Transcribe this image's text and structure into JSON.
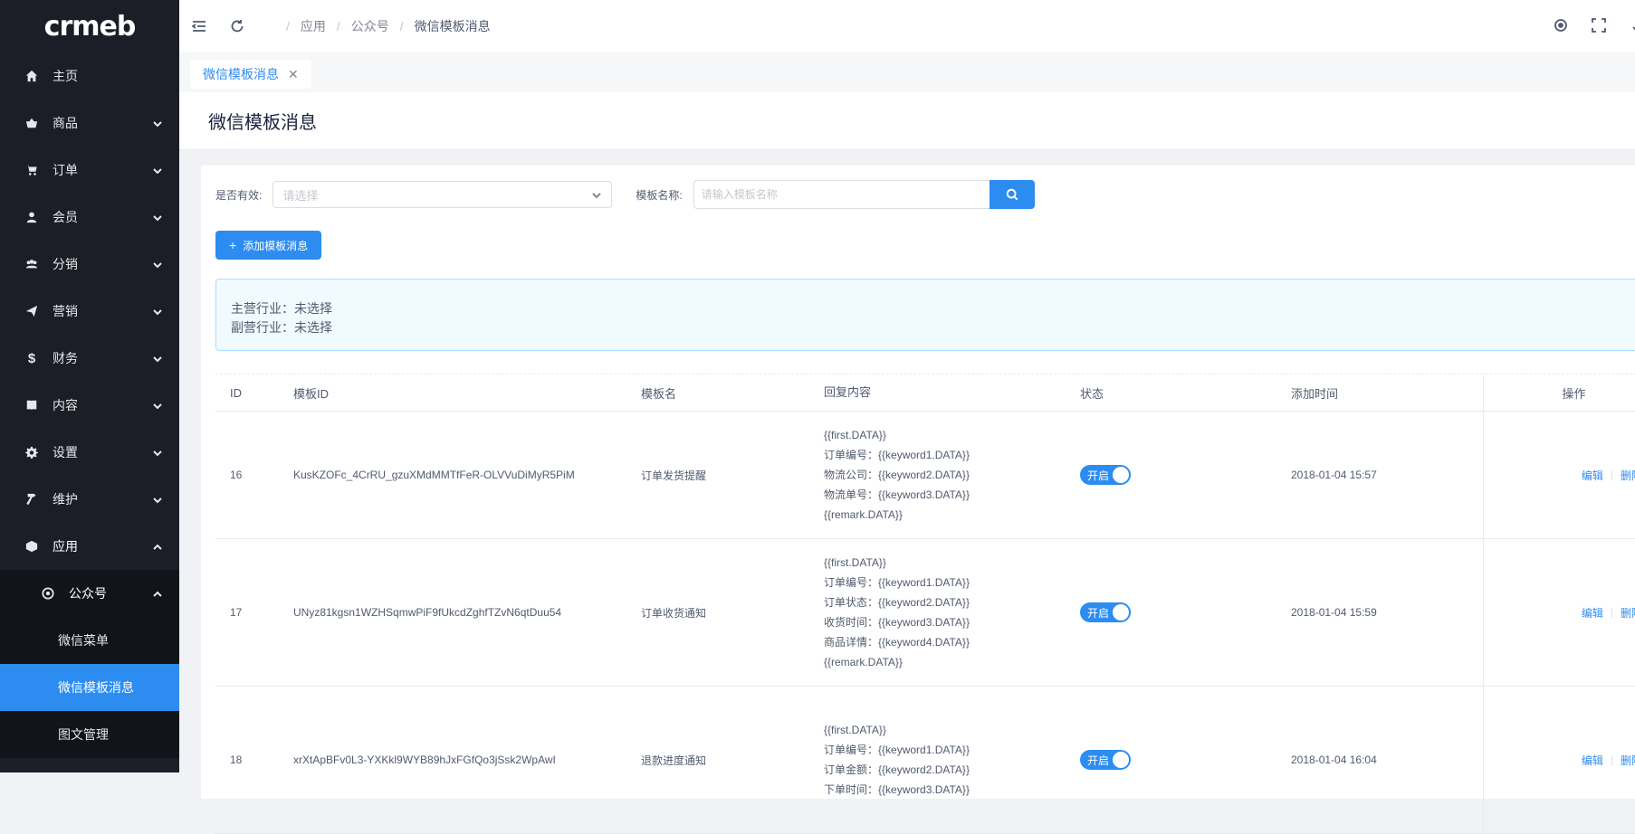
{
  "logo": "crmeb",
  "sidebar": {
    "items": [
      {
        "label": "主页",
        "icon": "home-icon"
      },
      {
        "label": "商品",
        "icon": "basket-icon"
      },
      {
        "label": "订单",
        "icon": "cart-icon"
      },
      {
        "label": "会员",
        "icon": "user-icon"
      },
      {
        "label": "分销",
        "icon": "team-icon"
      },
      {
        "label": "营销",
        "icon": "send-icon"
      },
      {
        "label": "财务",
        "icon": "dollar-icon"
      },
      {
        "label": "内容",
        "icon": "book-icon"
      },
      {
        "label": "设置",
        "icon": "gear-icon"
      },
      {
        "label": "维护",
        "icon": "hammer-icon"
      },
      {
        "label": "应用",
        "icon": "cube-icon"
      }
    ],
    "sub_group": {
      "label": "公众号",
      "icon": "wechat-icon"
    },
    "sub_items": [
      "微信菜单",
      "微信模板消息",
      "图文管理"
    ]
  },
  "breadcrumb": [
    "应用",
    "公众号",
    "微信模板消息"
  ],
  "tab": {
    "label": "微信模板消息",
    "close": "✕"
  },
  "page_title": "微信模板消息",
  "filters": {
    "valid_label": "是否有效:",
    "valid_placeholder": "请选择",
    "name_label": "模板名称:",
    "name_placeholder": "请输入模板名称"
  },
  "add_button": "添加模板消息",
  "notice": {
    "line1": "主营行业：未选择",
    "line2": "副营行业：未选择"
  },
  "table": {
    "headers": [
      "ID",
      "模板ID",
      "模板名",
      "回复内容",
      "状态",
      "添加时间",
      "操作"
    ],
    "rows": [
      {
        "id": "16",
        "template_id": "KusKZOFc_4CrRU_gzuXMdMMTfFeR-OLVVuDiMyR5PiM",
        "name": "订单发货提醒",
        "content": [
          "{{first.DATA}}",
          "订单编号：{{keyword1.DATA}}",
          "物流公司：{{keyword2.DATA}}",
          "物流单号：{{keyword3.DATA}}",
          "{{remark.DATA}}"
        ],
        "status": "开启",
        "time": "2018-01-04 15:57"
      },
      {
        "id": "17",
        "template_id": "UNyz81kgsn1WZHSqmwPiF9fUkcdZghfTZvN6qtDuu54",
        "name": "订单收货通知",
        "content": [
          "{{first.DATA}}",
          "订单编号：{{keyword1.DATA}}",
          "订单状态：{{keyword2.DATA}}",
          "收货时间：{{keyword3.DATA}}",
          "商品详情：{{keyword4.DATA}}",
          "{{remark.DATA}}"
        ],
        "status": "开启",
        "time": "2018-01-04 15:59"
      },
      {
        "id": "18",
        "template_id": "xrXtApBFv0L3-YXKkl9WYB89hJxFGfQo3jSsk2WpAwI",
        "name": "退款进度通知",
        "content": [
          "{{first.DATA}}",
          "订单编号：{{keyword1.DATA}}",
          "订单金额：{{keyword2.DATA}}",
          "下单时间：{{keyword3.DATA}}"
        ],
        "status": "开启",
        "time": "2018-01-04 16:04"
      }
    ],
    "edit_label": "编辑",
    "delete_label": "删除"
  },
  "colors": {
    "sidebar_bg": "#1b1e26",
    "accent": "#2d8cf0"
  }
}
